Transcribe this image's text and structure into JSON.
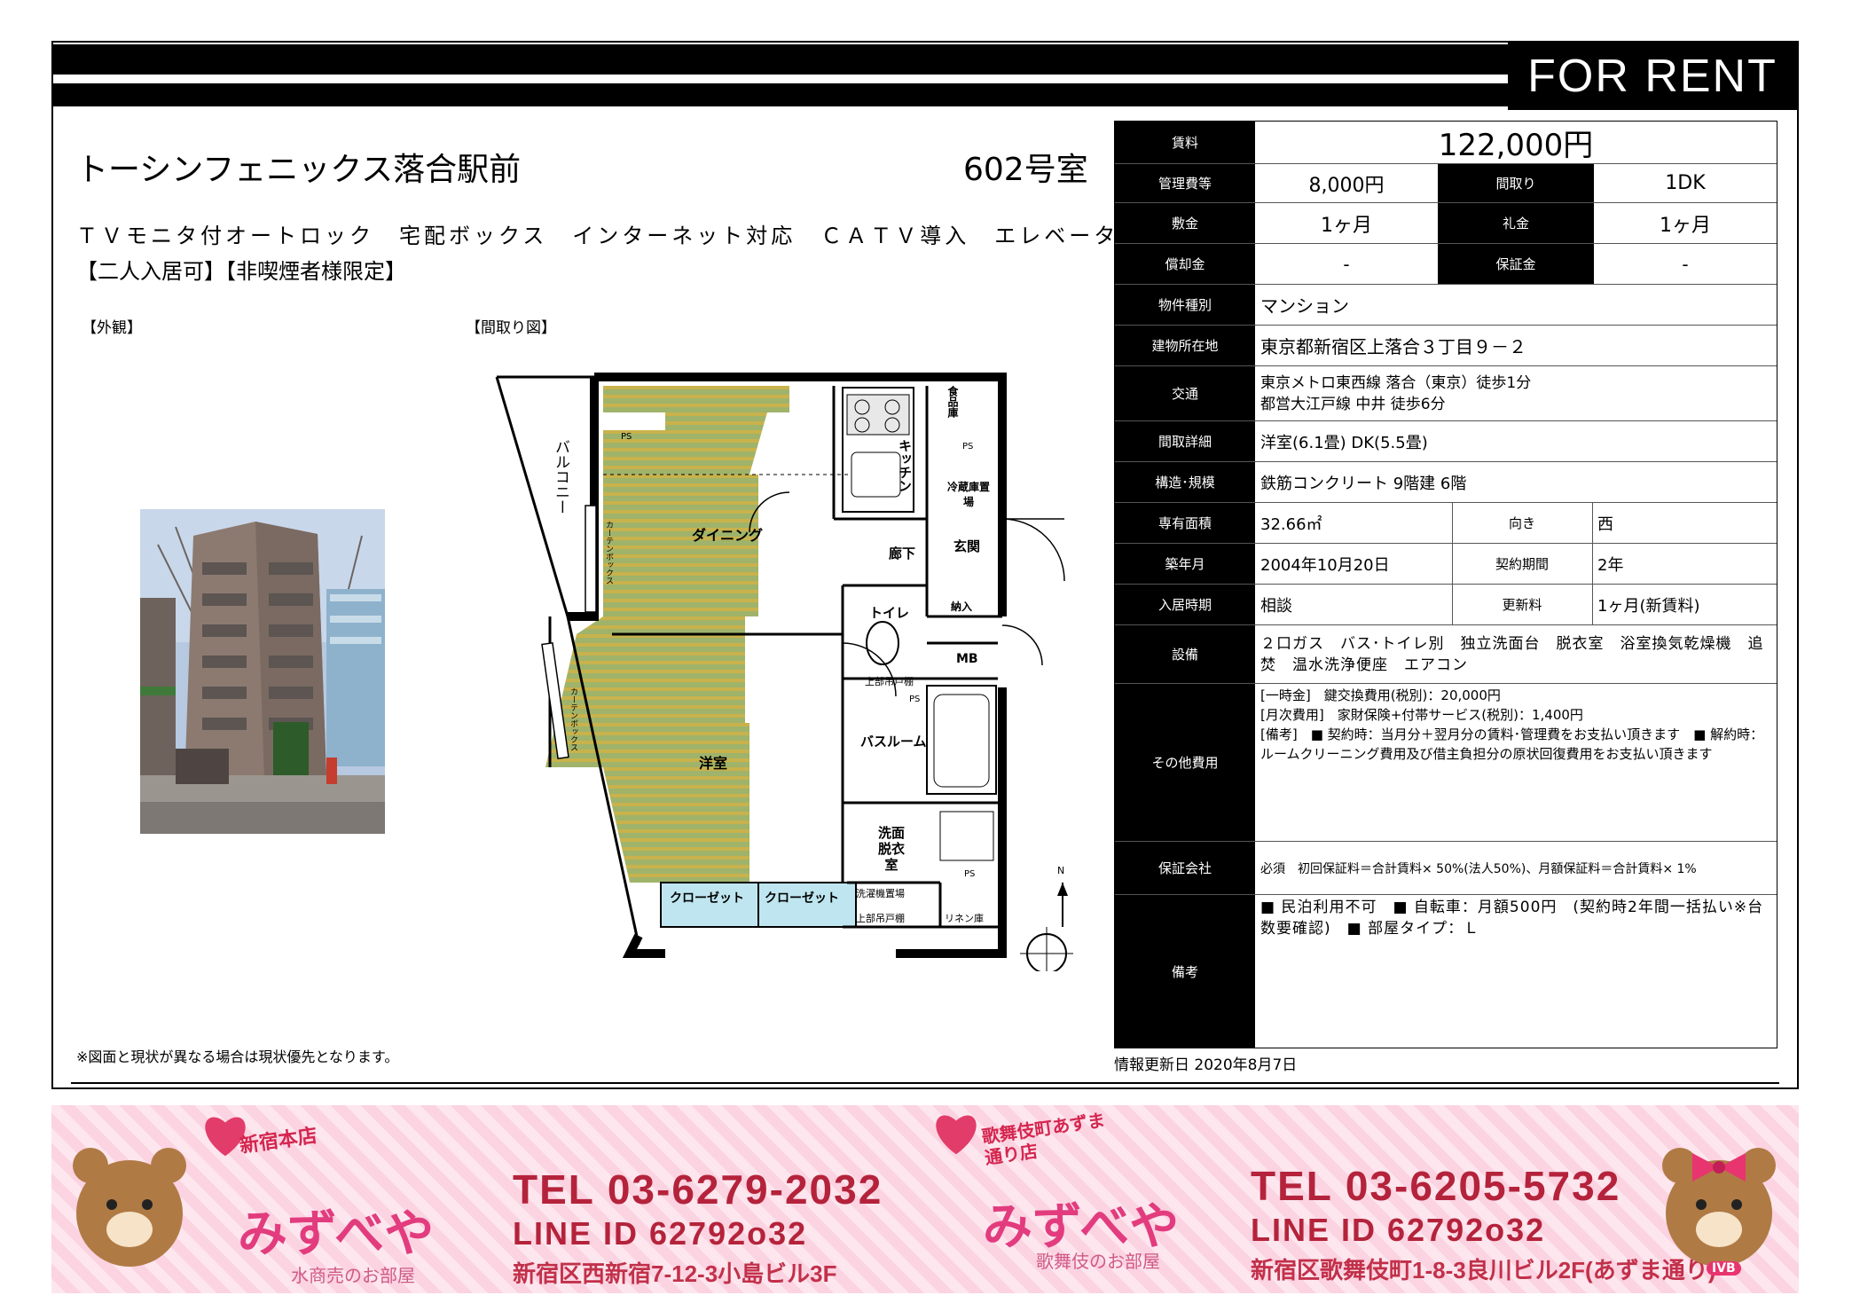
{
  "header": {
    "for_rent": "FOR RENT"
  },
  "property": {
    "name": "トーシンフェニックス落合駅前",
    "room": "602号室",
    "features": "ＴＶモニタ付オートロック　宅配ボックス　インターネット対応　ＣＡＴＶ導入　エレベーター",
    "conditions": "【二人入居可】【非喫煙者様限定】",
    "exterior_label": "【外観】",
    "floorplan_label": "【間取り図】",
    "note": "※図面と現状が異なる場合は現状優先となります。",
    "updated": "情報更新日 2020年8月7日"
  },
  "floorplan": {
    "rooms": {
      "balcony": "バルコニー",
      "dining": "ダイニング",
      "kitchen": "キッチン",
      "pantry": "食品庫",
      "fridge": "冷蔵庫置場",
      "hall": "廊下",
      "entrance": "玄関",
      "toilet": "トイレ",
      "storage": "納入",
      "mb": "MB",
      "shelf1": "上部吊戸棚",
      "bathroom": "バスルーム",
      "western": "洋室",
      "washroom": "洗面脱衣室",
      "closet1": "クローゼット",
      "closet2": "クローゼット",
      "washer": "洗濯機置場",
      "shelf2": "上部吊戸棚",
      "linen": "リネン庫",
      "curtain1": "カーテンボックス",
      "curtain2": "カーテンボックス",
      "ps1": "PS",
      "ps2": "PS",
      "ps3": "PS",
      "ps4": "PS",
      "north": "N"
    }
  },
  "spec": {
    "rent_label": "賃料",
    "rent": "122,000円",
    "mgmt_label": "管理費等",
    "mgmt": "8,000円",
    "layout_label": "間取り",
    "layout": "1DK",
    "deposit_label": "敷金",
    "deposit": "1ヶ月",
    "key_money_label": "礼金",
    "key_money": "1ヶ月",
    "amort_label": "償却金",
    "amort": "-",
    "guarantee_money_label": "保証金",
    "guarantee_money": "-",
    "type_label": "物件種別",
    "type": "マンション",
    "address_label": "建物所在地",
    "address": "東京都新宿区上落合３丁目９－２",
    "transit_label": "交通",
    "transit1": "東京メトロ東西線 落合（東京）徒歩1分",
    "transit2": "都営大江戸線 中井 徒歩6分",
    "detail_label": "間取詳細",
    "detail": "洋室(6.1畳) DK(5.5畳)",
    "structure_label": "構造･規模",
    "structure": "鉄筋コンクリート 9階建 6階",
    "area_label": "専有面積",
    "area": "32.66㎡",
    "direction_label": "向き",
    "direction": "西",
    "built_label": "築年月",
    "built": "2004年10月20日",
    "term_label": "契約期間",
    "term": "2年",
    "movein_label": "入居時期",
    "movein": "相談",
    "renewal_label": "更新料",
    "renewal": "1ヶ月(新賃料)",
    "equip_label": "設備",
    "equip": "２口ガス　バス･トイレ別　独立洗面台　脱衣室　浴室換気乾燥機　追焚　温水洗浄便座　エアコン",
    "other_label": "その他費用",
    "other1": "[一時金]　鍵交換費用(税別)：20,000円",
    "other2": "[月次費用]　家財保険+付帯サービス(税別)：1,400円",
    "other3": "[備考]　■ 契約時：当月分＋翌月分の賃料･管理費をお支払い頂きます　■ 解約時：ルームクリーニング費用及び借主負担分の原状回復費用をお支払い頂きます",
    "guarantor_label": "保証会社",
    "guarantor": "必須　初回保証料＝合計賃料× 50%(法人50%)、月額保証料＝合計賃料× 1%",
    "remarks_label": "備考",
    "remarks": "■ 民泊利用不可　■ 自転車：月額500円　(契約時2年間一括払い※台数要確認)　■ 部屋タイプ：Ｌ"
  },
  "banner": {
    "shop1_tag": "新宿本店",
    "shop1_name": "みずべや",
    "shop1_sub": "水商売のお部屋",
    "shop1_tel": "TEL 03-6279-2032",
    "shop1_line": "LINE ID 62792o32",
    "shop1_addr": "新宿区西新宿7-12-3小島ビル3F",
    "shop2_tag": "歌舞伎町あずま通り店",
    "shop2_name": "みずべや",
    "shop2_sub": "歌舞伎のお部屋",
    "shop2_tel": "TEL 03-6205-5732",
    "shop2_line": "LINE ID 62792o32",
    "shop2_addr": "新宿区歌舞伎町1-8-3良川ビル2F(あずま通り)",
    "bear_badge": "IVB"
  },
  "colors": {
    "floor_green": "#9fb36a",
    "floor_stripe": "#c9b24c",
    "closet_blue": "#bfe6f0",
    "banner_red": "#b4233b",
    "banner_pink": "#e23c7e"
  }
}
